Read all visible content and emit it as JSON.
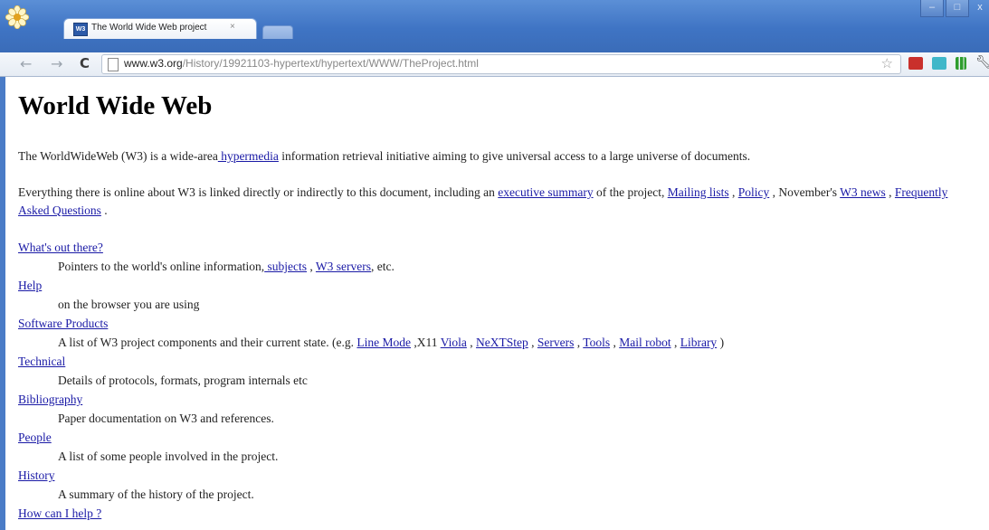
{
  "browser": {
    "tab_title": "The World Wide Web project",
    "tab_close": "×",
    "favicon_text": "W3",
    "url_host": "www.w3.org",
    "url_path": "/History/19921103-hypertext/hypertext/WWW/TheProject.html",
    "window_controls": {
      "minimize": "–",
      "maximize": "□",
      "close": "x"
    }
  },
  "page": {
    "title": "World Wide Web",
    "intro": {
      "before": "The WorldWideWeb (W3) is a wide-area",
      "link": " hypermedia",
      "after": " information retrieval initiative aiming to give universal access to a large universe of documents."
    },
    "para2": {
      "t1": "Everything there is online about W3 is linked directly or indirectly to this document, including an ",
      "l1": "executive summary",
      "t2": " of the project, ",
      "l2": "Mailing lists",
      "t3": " , ",
      "l3": "Policy",
      "t4": " , November's ",
      "l4": "W3 news",
      "t5": " , ",
      "l5": "Frequently Asked Questions",
      "t6": " ."
    },
    "sections": {
      "s1": {
        "term": "What's out there?",
        "desc1": "Pointers to the world's online information,",
        "l1": " subjects",
        "sep": " , ",
        "l2": "W3 servers",
        "desc2": ", etc."
      },
      "s2": {
        "term": "Help",
        "desc": "on the browser you are using"
      },
      "s3": {
        "term": "Software Products",
        "desc1": "A list of W3 project components and their current state. (e.g. ",
        "l1": "Line Mode",
        "t2": " ,X11 ",
        "l2": "Viola",
        "t3": " , ",
        "l3": "NeXTStep",
        "t4": " , ",
        "l4": "Servers",
        "t5": " , ",
        "l5": "Tools",
        "t6": " , ",
        "l6": "Mail robot",
        "t7": " , ",
        "l7": "Library",
        "t8": " )"
      },
      "s4": {
        "term": "Technical",
        "desc": "Details of protocols, formats, program internals etc"
      },
      "s5": {
        "term": "Bibliography",
        "desc": "Paper documentation on W3 and references."
      },
      "s6": {
        "term": "People",
        "desc": "A list of some people involved in the project."
      },
      "s7": {
        "term": "History",
        "desc": "A summary of the history of the project."
      },
      "s8": {
        "term": "How can I help ?"
      }
    }
  }
}
